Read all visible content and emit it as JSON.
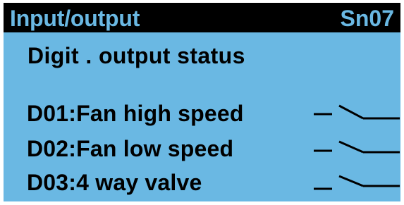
{
  "header": {
    "title": "Input/output",
    "code": "Sn07"
  },
  "subtitle": "Digit . output status",
  "outputs": [
    {
      "label": "D01:Fan high speed",
      "state": "open",
      "icon": "switch-open-icon"
    },
    {
      "label": "D02:Fan low speed",
      "state": "open",
      "icon": "switch-open-icon"
    },
    {
      "label": "D03:4 way valve",
      "state": "open",
      "icon": "switch-open-icon"
    }
  ],
  "colors": {
    "lcd_background": "#6ab8e3",
    "title_bar": "#000000",
    "text": "#000000"
  }
}
